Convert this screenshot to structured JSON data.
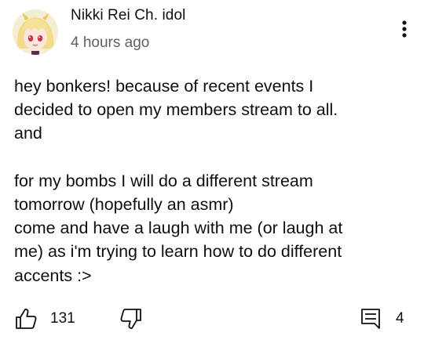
{
  "comment": {
    "author": "Nikki Rei Ch. idol",
    "timestamp": "4 hours ago",
    "body_lines": [
      "hey bonkers! because of recent events I",
      "decided to open my members stream to all.",
      "and",
      "",
      "for my bombs I will do a different stream",
      "tomorrow (hopefully an asmr)",
      "come and have a laugh with me (or laugh at",
      "me) as i'm trying to learn how to do different",
      "accents :>"
    ],
    "like_count": "131",
    "reply_count": "4"
  },
  "icons": {
    "avatar": "avatar-anime-girl",
    "more": "more-vertical-icon",
    "like": "thumbs-up-icon",
    "dislike": "thumbs-down-icon",
    "reply": "comment-icon"
  },
  "colors": {
    "text": "#0f0f0f",
    "secondary_text": "#606060",
    "background": "#ffffff"
  }
}
